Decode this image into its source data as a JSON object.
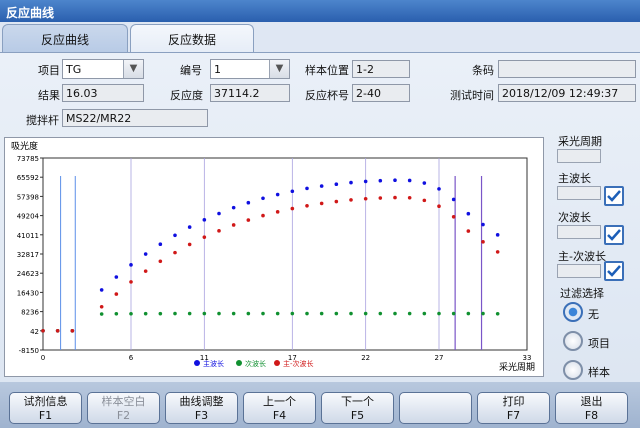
{
  "window": {
    "title": "反应曲线"
  },
  "tabs": [
    {
      "label": "反应曲线"
    },
    {
      "label": "反应数据"
    }
  ],
  "form": {
    "item_label": "项目",
    "item_value": "TG",
    "number_label": "编号",
    "number_value": "1",
    "sample_pos_label": "样本位置",
    "sample_pos_value": "1-2",
    "barcode_label": "条码",
    "barcode_value": "",
    "result_label": "结果",
    "result_value": "16.03",
    "reaction_label": "反应度",
    "reaction_value": "37114.2",
    "cup_label": "反应杯号",
    "cup_value": "2-40",
    "test_time_label": "测试时间",
    "test_time_value": "2018/12/09 12:49:37",
    "stirrer_label": "搅拌杆",
    "stirrer_value": "MS22/MR22"
  },
  "chart_data": {
    "type": "scatter",
    "ylabel": "吸光度",
    "xlabel": "采光周期",
    "xlim": [
      0,
      33
    ],
    "ylim": [
      -8150,
      73785
    ],
    "x_ticks": [
      "0",
      "6",
      "11",
      "17",
      "22",
      "27",
      "33"
    ],
    "x_tick_values": [
      0,
      6,
      11,
      17,
      22,
      27,
      33
    ],
    "y_ticks": [
      "73785",
      "65592",
      "57398",
      "49204",
      "41011",
      "32817",
      "24623",
      "16430",
      "8236",
      "42",
      "-8150"
    ],
    "vlines_blue": [
      1.2,
      2.2
    ],
    "vlines_purple": [
      28.1,
      29.9
    ],
    "legend": [
      "主波长",
      "次波长",
      "主-次波长"
    ],
    "series": [
      {
        "name": "主波长",
        "color": "#1010e0",
        "x": [
          0,
          1,
          2,
          4,
          5,
          6,
          7,
          8,
          9,
          10,
          11,
          12,
          13,
          14,
          15,
          16,
          17,
          18,
          19,
          20,
          21,
          22,
          23,
          24,
          25,
          26,
          27,
          28,
          29,
          30,
          31
        ],
        "y": [
          42,
          42,
          42,
          17500,
          23000,
          28200,
          32800,
          37000,
          40800,
          44300,
          47400,
          50100,
          52600,
          54700,
          56600,
          58200,
          59600,
          60800,
          61800,
          62600,
          63300,
          63800,
          64100,
          64300,
          64200,
          63100,
          60600,
          56100,
          50000,
          45400,
          41000
        ]
      },
      {
        "name": "次波长",
        "color": "#109030",
        "x": [
          0,
          1,
          2,
          4,
          5,
          6,
          7,
          8,
          9,
          10,
          11,
          12,
          13,
          14,
          15,
          16,
          17,
          18,
          19,
          20,
          21,
          22,
          23,
          24,
          25,
          26,
          27,
          28,
          29,
          30,
          31
        ],
        "y": [
          42,
          42,
          42,
          7200,
          7300,
          7300,
          7350,
          7350,
          7400,
          7400,
          7400,
          7400,
          7400,
          7400,
          7400,
          7400,
          7400,
          7400,
          7400,
          7400,
          7400,
          7400,
          7400,
          7400,
          7400,
          7400,
          7400,
          7400,
          7400,
          7400,
          7300
        ]
      },
      {
        "name": "主-次波长",
        "color": "#d01818",
        "x": [
          0,
          1,
          2,
          4,
          5,
          6,
          7,
          8,
          9,
          10,
          11,
          12,
          13,
          14,
          15,
          16,
          17,
          18,
          19,
          20,
          21,
          22,
          23,
          24,
          25,
          26,
          27,
          28,
          29,
          30,
          31
        ],
        "y": [
          42,
          42,
          42,
          10300,
          15700,
          20900,
          25500,
          29700,
          33400,
          36900,
          40000,
          42700,
          45200,
          47300,
          49200,
          50800,
          52200,
          53400,
          54400,
          55200,
          55900,
          56400,
          56700,
          56900,
          56800,
          55700,
          53200,
          48700,
          42600,
          38000,
          33700
        ]
      }
    ]
  },
  "side": {
    "period_label": "采光周期",
    "main_wave_label": "主波长",
    "sub_wave_label": "次波长",
    "diff_wave_label": "主-次波长",
    "filter_label": "过滤选择",
    "opt_none": "无",
    "opt_item": "项目",
    "opt_sample": "样本"
  },
  "footer": {
    "buttons": [
      {
        "label": "试剂信息",
        "key": "F1",
        "enabled": true
      },
      {
        "label": "样本空白",
        "key": "F2",
        "enabled": false
      },
      {
        "label": "曲线调整",
        "key": "F3",
        "enabled": true
      },
      {
        "label": "上一个",
        "key": "F4",
        "enabled": true
      },
      {
        "label": "下一个",
        "key": "F5",
        "enabled": true
      },
      {
        "label": "",
        "key": "",
        "enabled": false
      },
      {
        "label": "打印",
        "key": "F7",
        "enabled": true
      },
      {
        "label": "退出",
        "key": "F8",
        "enabled": true
      }
    ]
  },
  "colors": {
    "titlebar": "#2a5fae",
    "check": "#3a6fb8",
    "grid_v": "#a9a2e0",
    "vline_blue": "#5b8fe8",
    "vline_purple": "#7a55c8"
  }
}
